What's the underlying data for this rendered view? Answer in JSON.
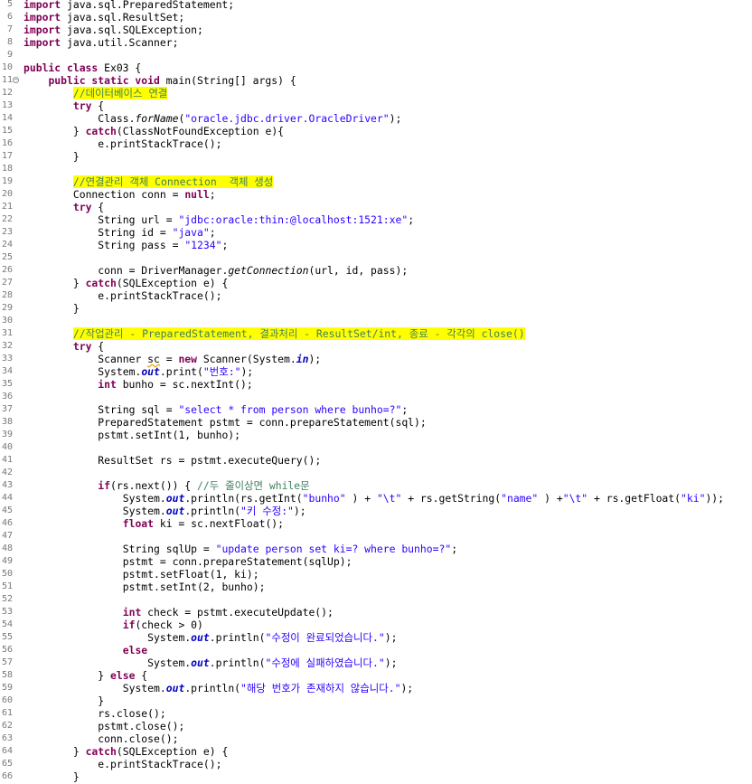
{
  "editor": {
    "language": "java",
    "colors": {
      "background": "#ffffff",
      "keyword": "#7f0055",
      "string": "#2a00ff",
      "comment": "#3f7f5f",
      "field": "#0000c0",
      "highlight": "#ffff00",
      "line_number": "#787878"
    },
    "fold_marker_line": 11,
    "lines": [
      {
        "n": "5",
        "t": [
          [
            "kw",
            "import"
          ],
          [
            "",
            "java.sql.PreparedStatement;"
          ]
        ]
      },
      {
        "n": "6",
        "t": [
          [
            "kw",
            "import"
          ],
          [
            "",
            "java.sql.ResultSet;"
          ]
        ]
      },
      {
        "n": "7",
        "t": [
          [
            "kw",
            "import"
          ],
          [
            "",
            "java.sql.SQLException;"
          ]
        ]
      },
      {
        "n": "8",
        "t": [
          [
            "kw",
            "import"
          ],
          [
            "",
            "java.util.Scanner;"
          ]
        ]
      },
      {
        "n": "9",
        "t": []
      },
      {
        "n": "10",
        "t": [
          [
            "kw",
            "public"
          ],
          [
            "",
            ""
          ],
          [
            "kw",
            "class"
          ],
          [
            "",
            "Ex03 {"
          ]
        ]
      },
      {
        "n": "11",
        "t": [
          [
            "",
            "    "
          ],
          [
            "kw",
            "public"
          ],
          [
            "",
            ""
          ],
          [
            "kw",
            "static"
          ],
          [
            "",
            ""
          ],
          [
            "kw",
            "void"
          ],
          [
            "",
            "main(String[] args) {"
          ]
        ]
      },
      {
        "n": "12",
        "t": [
          [
            "",
            "        "
          ],
          [
            "cmhl",
            "//데이터베이스 연결"
          ]
        ]
      },
      {
        "n": "13",
        "t": [
          [
            "",
            "        "
          ],
          [
            "kw",
            "try"
          ],
          [
            "",
            " {"
          ]
        ]
      },
      {
        "n": "14",
        "t": [
          [
            "",
            "            Class."
          ],
          [
            "st",
            "forName"
          ],
          [
            "",
            "("
          ],
          [
            "str",
            "\"oracle.jdbc.driver.OracleDriver\""
          ],
          [
            "",
            ");"
          ]
        ]
      },
      {
        "n": "15",
        "t": [
          [
            "",
            "        } "
          ],
          [
            "kw",
            "catch"
          ],
          [
            "",
            "(ClassNotFoundException e){"
          ]
        ]
      },
      {
        "n": "16",
        "t": [
          [
            "",
            "            e.printStackTrace();"
          ]
        ]
      },
      {
        "n": "17",
        "t": [
          [
            "",
            "        }"
          ]
        ]
      },
      {
        "n": "18",
        "t": []
      },
      {
        "n": "19",
        "t": [
          [
            "",
            "        "
          ],
          [
            "cmhl",
            "//연결관리 객체 Connection  객체 생성"
          ]
        ]
      },
      {
        "n": "20",
        "t": [
          [
            "",
            "        Connection conn = "
          ],
          [
            "kw",
            "null"
          ],
          [
            "",
            ";"
          ]
        ]
      },
      {
        "n": "21",
        "t": [
          [
            "",
            "        "
          ],
          [
            "kw",
            "try"
          ],
          [
            "",
            " {"
          ]
        ]
      },
      {
        "n": "22",
        "t": [
          [
            "",
            "            String url = "
          ],
          [
            "str",
            "\"jdbc:oracle:thin:@localhost:1521:xe\""
          ],
          [
            "",
            ";"
          ]
        ]
      },
      {
        "n": "23",
        "t": [
          [
            "",
            "            String id = "
          ],
          [
            "str",
            "\"java\""
          ],
          [
            "",
            ";"
          ]
        ]
      },
      {
        "n": "24",
        "t": [
          [
            "",
            "            String pass = "
          ],
          [
            "str",
            "\"1234\""
          ],
          [
            "",
            ";"
          ]
        ]
      },
      {
        "n": "25",
        "t": []
      },
      {
        "n": "26",
        "t": [
          [
            "",
            "            conn = DriverManager."
          ],
          [
            "st",
            "getConnection"
          ],
          [
            "",
            "(url, id, pass);"
          ]
        ]
      },
      {
        "n": "27",
        "t": [
          [
            "",
            "        } "
          ],
          [
            "kw",
            "catch"
          ],
          [
            "",
            "(SQLException e) {"
          ]
        ]
      },
      {
        "n": "28",
        "t": [
          [
            "",
            "            e.printStackTrace();"
          ]
        ]
      },
      {
        "n": "29",
        "t": [
          [
            "",
            "        }"
          ]
        ]
      },
      {
        "n": "30",
        "t": []
      },
      {
        "n": "31",
        "t": [
          [
            "",
            "        "
          ],
          [
            "cmhl",
            "//작업관리 - PreparedStatement, 결과처리 - ResultSet/int, 종료 - 각각의 close()"
          ]
        ]
      },
      {
        "n": "32",
        "t": [
          [
            "",
            "        "
          ],
          [
            "kw",
            "try"
          ],
          [
            "",
            " {"
          ]
        ]
      },
      {
        "n": "33",
        "t": [
          [
            "",
            "            Scanner "
          ],
          [
            "warn",
            "sc"
          ],
          [
            "",
            " = "
          ],
          [
            "kw",
            "new"
          ],
          [
            "",
            "Scanner(System."
          ],
          [
            "fld",
            "in"
          ],
          [
            "",
            ");"
          ]
        ]
      },
      {
        "n": "34",
        "t": [
          [
            "",
            "            System."
          ],
          [
            "fld",
            "out"
          ],
          [
            "",
            ".print("
          ],
          [
            "str",
            "\"번호:\""
          ],
          [
            "",
            ");"
          ]
        ]
      },
      {
        "n": "35",
        "t": [
          [
            "",
            "            "
          ],
          [
            "kw",
            "int"
          ],
          [
            "",
            "bunho = sc.nextInt();"
          ]
        ]
      },
      {
        "n": "36",
        "t": []
      },
      {
        "n": "37",
        "t": [
          [
            "",
            "            String sql = "
          ],
          [
            "str",
            "\"select * from person where bunho=?\""
          ],
          [
            "",
            ";"
          ]
        ]
      },
      {
        "n": "38",
        "t": [
          [
            "",
            "            PreparedStatement pstmt = conn.prepareStatement(sql);"
          ]
        ]
      },
      {
        "n": "39",
        "t": [
          [
            "",
            "            pstmt.setInt(1, bunho);"
          ]
        ]
      },
      {
        "n": "40",
        "t": []
      },
      {
        "n": "41",
        "t": [
          [
            "",
            "            ResultSet rs = pstmt.executeQuery();"
          ]
        ]
      },
      {
        "n": "42",
        "t": []
      },
      {
        "n": "43",
        "t": [
          [
            "",
            "            "
          ],
          [
            "kw",
            "if"
          ],
          [
            "",
            "(rs.next()) { "
          ],
          [
            "cm",
            "//두 줄이상면 while문"
          ]
        ]
      },
      {
        "n": "44",
        "t": [
          [
            "",
            "                System."
          ],
          [
            "fld",
            "out"
          ],
          [
            "",
            ".println(rs.getInt("
          ],
          [
            "str",
            "\"bunho\""
          ],
          [
            "",
            " ) + "
          ],
          [
            "str",
            "\"\\t\""
          ],
          [
            "",
            " + rs.getString("
          ],
          [
            "str",
            "\"name\""
          ],
          [
            "",
            " ) +"
          ],
          [
            "str",
            "\"\\t\""
          ],
          [
            "",
            " + rs.getFloat("
          ],
          [
            "str",
            "\"ki\""
          ],
          [
            "",
            "));"
          ]
        ]
      },
      {
        "n": "45",
        "t": [
          [
            "",
            "                System."
          ],
          [
            "fld",
            "out"
          ],
          [
            "",
            ".println("
          ],
          [
            "str",
            "\"키 수정:\""
          ],
          [
            "",
            ");"
          ]
        ]
      },
      {
        "n": "46",
        "t": [
          [
            "",
            "                "
          ],
          [
            "kw",
            "float"
          ],
          [
            "",
            "ki = sc.nextFloat();"
          ]
        ]
      },
      {
        "n": "47",
        "t": []
      },
      {
        "n": "48",
        "t": [
          [
            "",
            "                String sqlUp = "
          ],
          [
            "str",
            "\"update person set ki=? where bunho=?\""
          ],
          [
            "",
            ";"
          ]
        ]
      },
      {
        "n": "49",
        "t": [
          [
            "",
            "                pstmt = conn.prepareStatement(sqlUp);"
          ]
        ]
      },
      {
        "n": "50",
        "t": [
          [
            "",
            "                pstmt.setFloat(1, ki);"
          ]
        ]
      },
      {
        "n": "51",
        "t": [
          [
            "",
            "                pstmt.setInt(2, bunho);"
          ]
        ]
      },
      {
        "n": "52",
        "t": []
      },
      {
        "n": "53",
        "t": [
          [
            "",
            "                "
          ],
          [
            "kw",
            "int"
          ],
          [
            "",
            "check = pstmt.executeUpdate();"
          ]
        ]
      },
      {
        "n": "54",
        "t": [
          [
            "",
            "                "
          ],
          [
            "kw",
            "if"
          ],
          [
            "",
            "(check > 0)"
          ]
        ]
      },
      {
        "n": "55",
        "t": [
          [
            "",
            "                    System."
          ],
          [
            "fld",
            "out"
          ],
          [
            "",
            ".println("
          ],
          [
            "str",
            "\"수정이 완료되었습니다.\""
          ],
          [
            "",
            ");"
          ]
        ]
      },
      {
        "n": "56",
        "t": [
          [
            "",
            "                "
          ],
          [
            "kw",
            "else"
          ]
        ]
      },
      {
        "n": "57",
        "t": [
          [
            "",
            "                    System."
          ],
          [
            "fld",
            "out"
          ],
          [
            "",
            ".println("
          ],
          [
            "str",
            "\"수정에 실패하였습니다.\""
          ],
          [
            "",
            ");"
          ]
        ]
      },
      {
        "n": "58",
        "t": [
          [
            "",
            "            } "
          ],
          [
            "kw",
            "else"
          ],
          [
            "",
            " {"
          ]
        ]
      },
      {
        "n": "59",
        "t": [
          [
            "",
            "                System."
          ],
          [
            "fld",
            "out"
          ],
          [
            "",
            ".println("
          ],
          [
            "str",
            "\"해당 번호가 존재하지 않습니다.\""
          ],
          [
            "",
            ");"
          ]
        ]
      },
      {
        "n": "60",
        "t": [
          [
            "",
            "            }"
          ]
        ]
      },
      {
        "n": "61",
        "t": [
          [
            "",
            "            rs.close();"
          ]
        ]
      },
      {
        "n": "62",
        "t": [
          [
            "",
            "            pstmt.close();"
          ]
        ]
      },
      {
        "n": "63",
        "t": [
          [
            "",
            "            conn.close();"
          ]
        ]
      },
      {
        "n": "64",
        "t": [
          [
            "",
            "        } "
          ],
          [
            "kw",
            "catch"
          ],
          [
            "",
            "(SQLException e) {"
          ]
        ]
      },
      {
        "n": "65",
        "t": [
          [
            "",
            "            e.printStackTrace();"
          ]
        ]
      },
      {
        "n": "66",
        "t": [
          [
            "",
            "        }"
          ]
        ]
      }
    ]
  }
}
